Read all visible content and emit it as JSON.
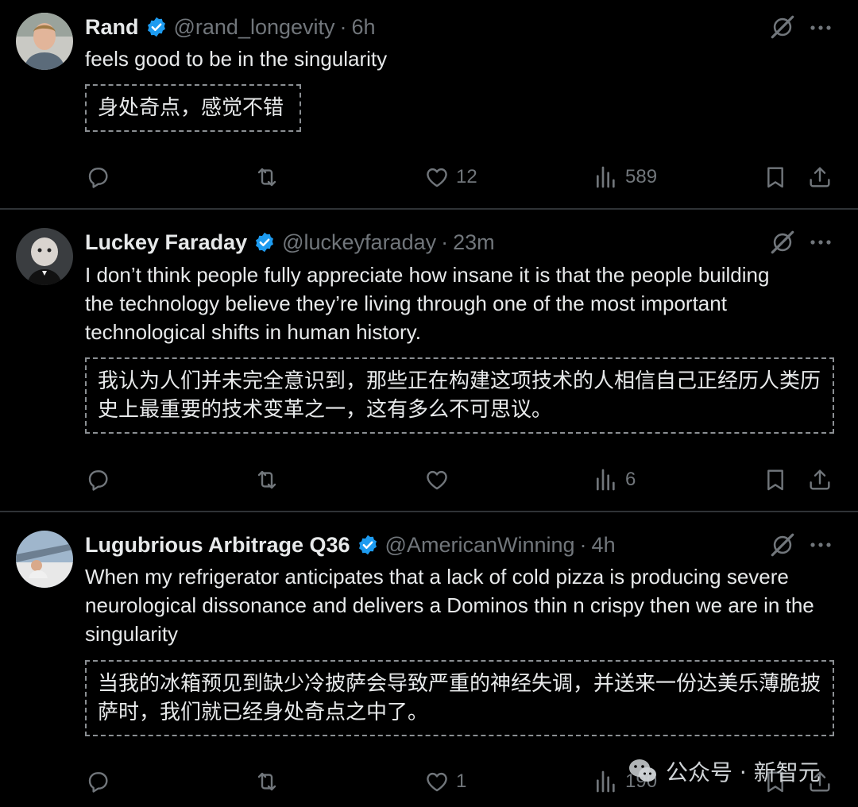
{
  "tweets": [
    {
      "name": "Rand",
      "handle": "@rand_longevity",
      "sep": "·",
      "time": "6h",
      "text": "feels good to be in the singularity",
      "translation": "身处奇点，感觉不错",
      "likes": "12",
      "views": "589"
    },
    {
      "name": "Luckey Faraday",
      "handle": "@luckeyfaraday",
      "sep": "·",
      "time": "23m",
      "text": "I don’t think people fully appreciate how insane it is that the people building the technology believe they’re living through one of the most important technological shifts in human history.",
      "translation": "我认为人们并未完全意识到，那些正在构建这项技术的人相信自己正经历人类历史上最重要的技术变革之一，这有多么不可思议。",
      "likes": "",
      "views": "6"
    },
    {
      "name": "Lugubrious Arbitrage Q36",
      "handle": "@AmericanWinning",
      "sep": "·",
      "time": "4h",
      "text": "When my refrigerator anticipates that a lack of cold pizza is producing severe neurological dissonance and delivers a Dominos thin n crispy then we are in the singularity",
      "translation": "当我的冰箱预见到缺少冷披萨会导致严重的神经失调，并送来一份达美乐薄脆披萨时，我们就已经身处奇点之中了。",
      "likes": "1",
      "views": "190"
    }
  ],
  "watermark": "公众号 · 新智元",
  "colors": {
    "background": "#000000",
    "text": "#e7e9ea",
    "muted": "#71767b",
    "verified": "#1d9bf0"
  },
  "icons": [
    "reply-icon",
    "retweet-icon",
    "like-icon",
    "views-icon",
    "bookmark-icon",
    "share-icon",
    "grok-icon",
    "more-icon",
    "verified-icon",
    "wechat-icon"
  ]
}
